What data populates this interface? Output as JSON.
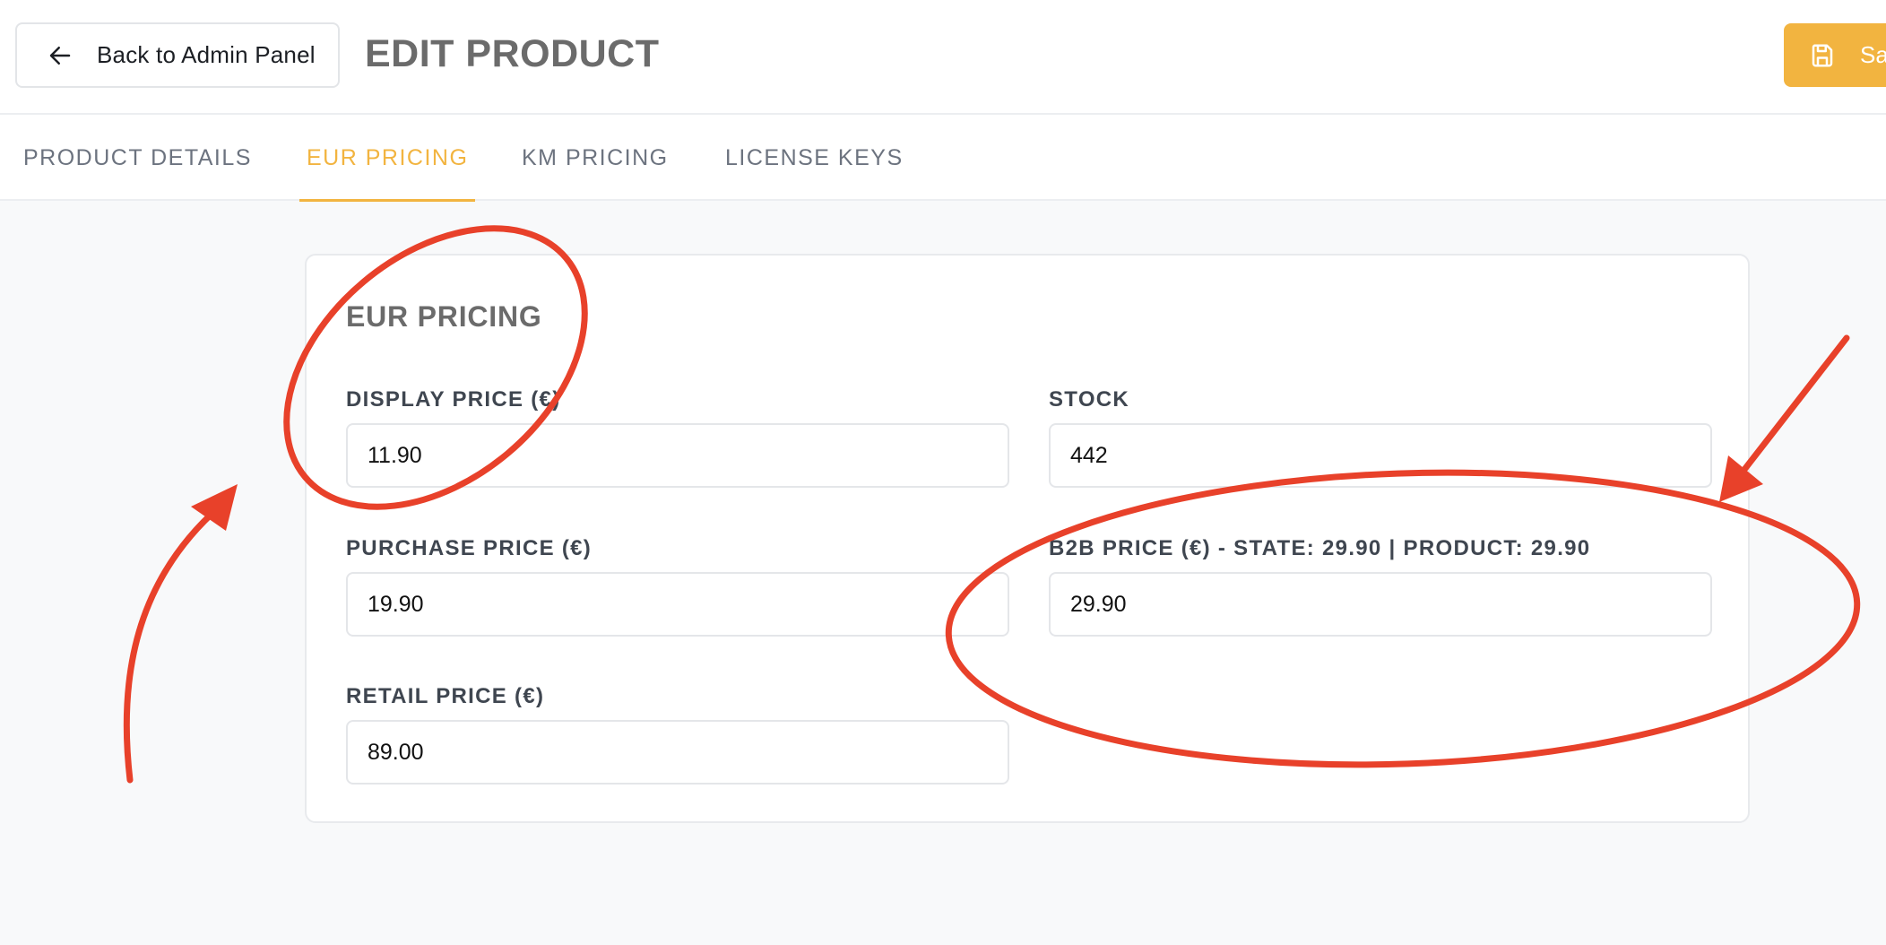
{
  "header": {
    "back_label": "Back to Admin Panel",
    "title": "EDIT PRODUCT",
    "save_label": "Sa"
  },
  "tabs": [
    {
      "label": "PRODUCT DETAILS",
      "active": false
    },
    {
      "label": "EUR PRICING",
      "active": true
    },
    {
      "label": "KM PRICING",
      "active": false
    },
    {
      "label": "LICENSE KEYS",
      "active": false
    }
  ],
  "card": {
    "title": "EUR PRICING",
    "fields": {
      "display_price": {
        "label": "DISPLAY PRICE (€)",
        "value": "11.90"
      },
      "stock": {
        "label": "STOCK",
        "value": "442"
      },
      "purchase_price": {
        "label": "PURCHASE PRICE (€)",
        "value": "19.90"
      },
      "b2b_price": {
        "label": "B2B PRICE (€) - STATE: 29.90 | PRODUCT: 29.90",
        "value": "29.90"
      },
      "retail_price": {
        "label": "RETAIL PRICE (€)",
        "value": "89.00"
      }
    }
  },
  "colors": {
    "accent": "#f2b440",
    "annotation": "#e8412a"
  }
}
